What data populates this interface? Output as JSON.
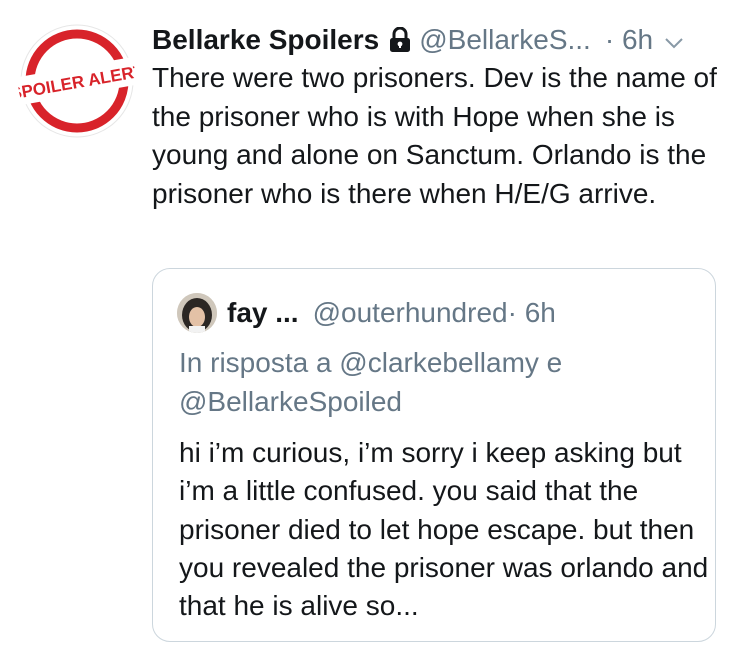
{
  "tweet": {
    "author_name": "Bellarke Spoilers",
    "author_handle": "@BellarkeS...",
    "time": "· 6h",
    "avatar_text": "SPOILER ALERT",
    "text": "There were two prisoners. Dev is the name of the prisoner who is with Hope when she is young and alone on Sanctum. Orlando is the prisoner who is there when H/E/G arrive."
  },
  "quoted_tweet": {
    "author_name": "fay ...",
    "author_handle": "@outerhundred",
    "time": "· 6h",
    "reply_to": "In risposta a @clarkebellamy e @BellarkeSpoiled",
    "text": "hi i’m curious, i’m sorry i keep asking but i’m a little confused. you said that the prisoner died to let hope escape. but then you revealed the prisoner was orlando and that he is alive so..."
  },
  "colors": {
    "text_primary": "#14171a",
    "text_secondary": "#657786",
    "border": "#ccd6dd",
    "stamp_red": "#d8232a"
  },
  "icons": [
    "lock-icon",
    "chevron-down-icon"
  ]
}
